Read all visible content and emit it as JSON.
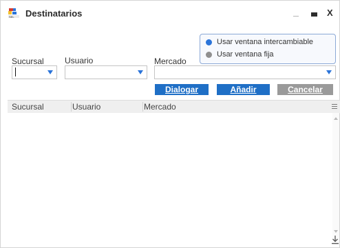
{
  "window": {
    "title": "Destinatarios",
    "close_label": "X"
  },
  "mode": {
    "options": [
      {
        "label": "Usar ventana intercambiable",
        "selected": true
      },
      {
        "label": "Usar ventana fija",
        "selected": false
      }
    ],
    "colors": {
      "selected": "#2b74d9",
      "unselected": "#8f8f8f"
    }
  },
  "fields": {
    "sucursal": {
      "label": "Sucursal",
      "value": ""
    },
    "usuario": {
      "label": "Usuario",
      "value": ""
    },
    "mercado": {
      "label": "Mercado",
      "value": ""
    }
  },
  "buttons": {
    "dialogar": "Dialogar",
    "anadir": "Añadir",
    "cancelar": "Cancelar"
  },
  "grid": {
    "columns": [
      "Sucursal",
      "Usuario",
      "Mercado"
    ],
    "rows": []
  },
  "icons": {
    "app_logo": "app-logo-icon",
    "minimize": "minimize-icon",
    "maximize": "maximize-icon",
    "close": "close-icon",
    "dropdown": "chevron-down-icon",
    "grid_menu": "grid-menu-icon",
    "download": "download-icon"
  },
  "colors": {
    "accent": "#1f6fc6",
    "disabled_button": "#9a9a9a"
  }
}
